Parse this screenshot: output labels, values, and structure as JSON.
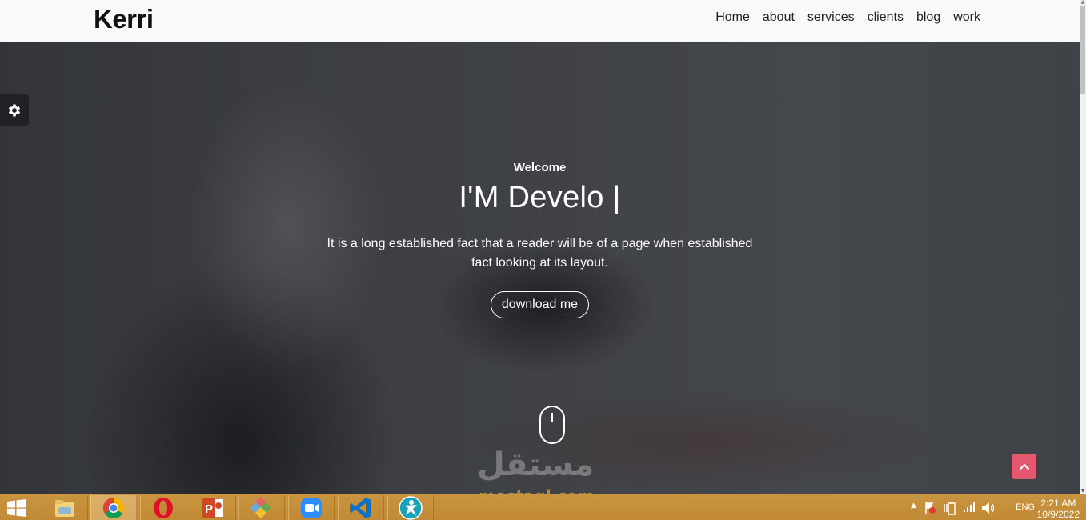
{
  "navbar": {
    "brand": "Kerri",
    "links": [
      {
        "label": "Home"
      },
      {
        "label": "about"
      },
      {
        "label": "services"
      },
      {
        "label": "clients"
      },
      {
        "label": "blog"
      },
      {
        "label": "work"
      }
    ]
  },
  "hero": {
    "welcome": "Welcome",
    "headline": "I'M Develo |",
    "description": "It is a long established fact that a reader will be of a page when established fact looking at its layout.",
    "download_label": "download me"
  },
  "icons": {
    "settings": "gear-icon",
    "scroll_down": "mouse-icon",
    "back_to_top": "chevron-up-icon"
  },
  "colors": {
    "accent": "#e2586f",
    "navbar_bg": "#f8f9fa",
    "taskbar_bg": "#c28a36"
  },
  "watermark": {
    "arabic": "مستقل",
    "latin": "mostaql.com"
  },
  "taskbar": {
    "apps": [
      {
        "name": "file-explorer"
      },
      {
        "name": "chrome"
      },
      {
        "name": "opera"
      },
      {
        "name": "powerpoint"
      },
      {
        "name": "paint-app"
      },
      {
        "name": "zoom"
      },
      {
        "name": "vs-code"
      },
      {
        "name": "accessibility-app"
      }
    ],
    "language": "ENG",
    "time": "2:21 AM",
    "date": "10/9/2022"
  }
}
